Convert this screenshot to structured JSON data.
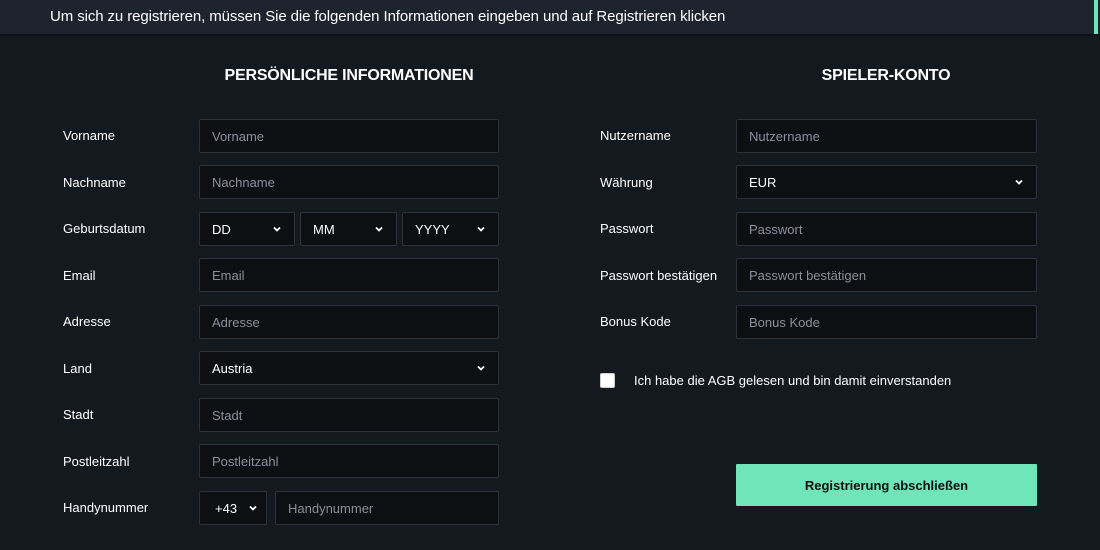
{
  "header": {
    "instruction": "Um sich zu registrieren, müssen Sie die folgenden Informationen eingeben und auf Registrieren klicken",
    "accent_color": "#6fe6b9"
  },
  "personal": {
    "title": "PERSÖNLICHE INFORMATIONEN",
    "fields": {
      "first_name": {
        "label": "Vorname",
        "placeholder": "Vorname",
        "value": ""
      },
      "last_name": {
        "label": "Nachname",
        "placeholder": "Nachname",
        "value": ""
      },
      "birthdate": {
        "label": "Geburtsdatum",
        "day": "DD",
        "month": "MM",
        "year": "YYYY"
      },
      "email": {
        "label": "Email",
        "placeholder": "Email",
        "value": ""
      },
      "address": {
        "label": "Adresse",
        "placeholder": "Adresse",
        "value": ""
      },
      "country": {
        "label": "Land",
        "selected": "Austria"
      },
      "city": {
        "label": "Stadt",
        "placeholder": "Stadt",
        "value": ""
      },
      "postal_code": {
        "label": "Postleitzahl",
        "placeholder": "Postleitzahl",
        "value": ""
      },
      "phone": {
        "label": "Handynummer",
        "prefix": "+43",
        "placeholder": "Handynummer",
        "value": ""
      }
    }
  },
  "account": {
    "title": "SPIELER-KONTO",
    "fields": {
      "username": {
        "label": "Nutzername",
        "placeholder": "Nutzername",
        "value": ""
      },
      "currency": {
        "label": "Währung",
        "selected": "EUR"
      },
      "password": {
        "label": "Passwort",
        "placeholder": "Passwort",
        "value": ""
      },
      "password_confirm": {
        "label": "Passwort bestätigen",
        "placeholder": "Passwort bestätigen",
        "value": ""
      },
      "bonus_code": {
        "label": "Bonus Kode",
        "placeholder": "Bonus Kode",
        "value": ""
      }
    },
    "terms": {
      "label": "Ich habe die AGB gelesen und bin damit einverstanden",
      "checked": false
    },
    "submit_label": "Registrierung abschließen",
    "submit_color": "#6fe6b9"
  }
}
